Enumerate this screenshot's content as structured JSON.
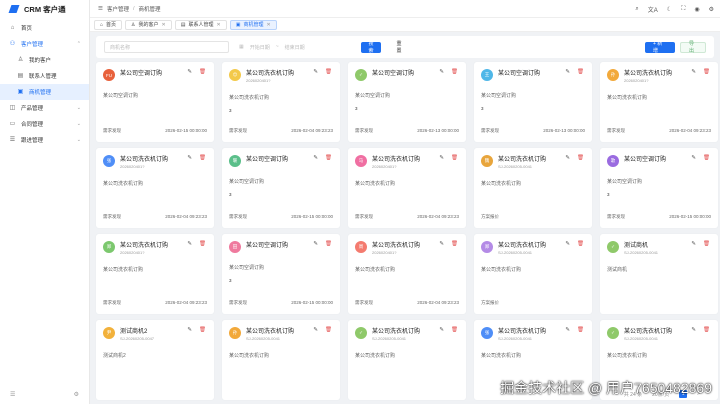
{
  "app": {
    "title": "CRM 客户通"
  },
  "sidebar": {
    "items": [
      {
        "label": "首页",
        "icon": "home-icon"
      },
      {
        "label": "客户管理",
        "icon": "user-group-icon"
      },
      {
        "label": "我的客户",
        "icon": "user-icon"
      },
      {
        "label": "联系人管理",
        "icon": "contact-icon"
      },
      {
        "label": "商机管理",
        "icon": "opportunity-icon"
      },
      {
        "label": "产品管理",
        "icon": "product-icon"
      },
      {
        "label": "合同管理",
        "icon": "contract-icon"
      },
      {
        "label": "跟进管理",
        "icon": "followup-icon"
      }
    ]
  },
  "breadcrumb": {
    "items": [
      "客户管理",
      "商机管理"
    ]
  },
  "topbar": {
    "lang": "文A"
  },
  "tabs": [
    {
      "label": "首页"
    },
    {
      "label": "我的客户"
    },
    {
      "label": "联系人管理"
    },
    {
      "label": "商机管理"
    }
  ],
  "filter": {
    "name_placeholder": "商机名称",
    "start_placeholder": "开始日期",
    "to": "~",
    "end_placeholder": "结束日期",
    "search_label": "搜索",
    "reset_label": "重置",
    "add_label": "+ 新增",
    "export_label": "导出"
  },
  "cards": [
    {
      "av": "FU",
      "color": "#e8613c",
      "name": "某公司空调订购",
      "id": "",
      "desc": "某公司空调订购",
      "num": "",
      "stage": "需求发现",
      "date": "2026-02-15 00:00:00"
    },
    {
      "av": "😊",
      "color": "#f3c94a",
      "name": "某公司洗衣机订购",
      "id": "2026020401?",
      "desc": "某公司洗衣机订购",
      "num": "3",
      "stage": "需求发现",
      "date": "2026-02-04 09:23:23"
    },
    {
      "av": "✓",
      "color": "#8fc96a",
      "name": "某公司空调订购",
      "id": "",
      "desc": "某公司空调订购",
      "num": "3",
      "stage": "需求发现",
      "date": "2026-02-13 00:00:00"
    },
    {
      "av": "王",
      "color": "#4fb7e8",
      "name": "某公司空调订购",
      "id": "",
      "desc": "某公司空调订购",
      "num": "3",
      "stage": "需求发现",
      "date": "2026-02-13 00:00:00"
    },
    {
      "av": "孙",
      "color": "#f2a93b",
      "name": "某公司洗衣机订购",
      "id": "2026020401?",
      "desc": "某公司洗衣机订购",
      "num": "",
      "stage": "需求发现",
      "date": "2026-02-04 09:23:23"
    },
    {
      "av": "张",
      "color": "#4f8ef7",
      "name": "某公司洗衣机订购",
      "id": "2026020401?",
      "desc": "某公司洗衣机订购",
      "num": "",
      "stage": "需求发现",
      "date": "2026-02-04 09:23:23"
    },
    {
      "av": "暖",
      "color": "#5bbf8a",
      "name": "某公司空调订购",
      "id": "",
      "desc": "某公司空调订购",
      "num": "3",
      "stage": "需求发现",
      "date": "2026-02-15 00:00:00"
    },
    {
      "av": "马",
      "color": "#f06fa2",
      "name": "某公司洗衣机订购",
      "id": "2026020401?",
      "desc": "某公司洗衣机订购",
      "num": "",
      "stage": "需求发现",
      "date": "2026-02-04 09:23:23"
    },
    {
      "av": "魏",
      "color": "#e8a53c",
      "name": "某公司洗衣机订购",
      "id": "SJ-20260205-0041",
      "desc": "某公司洗衣机订购",
      "num": "",
      "stage": "方案报价",
      "date": ""
    },
    {
      "av": "歌",
      "color": "#9a6be0",
      "name": "某公司空调订购",
      "id": "",
      "desc": "某公司空调订购",
      "num": "3",
      "stage": "需求发现",
      "date": "2026-02-15 00:00:00"
    },
    {
      "av": "郑",
      "color": "#7cc86e",
      "name": "某公司洗衣机订购",
      "id": "2026020401?",
      "desc": "某公司洗衣机订购",
      "num": "",
      "stage": "需求发现",
      "date": "2026-02-04 09:23:23"
    },
    {
      "av": "田",
      "color": "#ef7a9e",
      "name": "某公司空调订购",
      "id": "",
      "desc": "某公司空调订购",
      "num": "3",
      "stage": "需求发现",
      "date": "2026-02-15 00:00:00"
    },
    {
      "av": "周",
      "color": "#f47b6f",
      "name": "某公司洗衣机订购",
      "id": "2026020401?",
      "desc": "某公司洗衣机订购",
      "num": "",
      "stage": "需求发现",
      "date": "2026-02-04 09:23:23"
    },
    {
      "av": "郑",
      "color": "#b48be6",
      "name": "某公司洗衣机订购",
      "id": "SJ-20260205-0041",
      "desc": "某公司洗衣机订购",
      "num": "",
      "stage": "方案报价",
      "date": ""
    },
    {
      "av": "✓",
      "color": "#8fc96a",
      "name": "测试商机",
      "id": "SJ-20260205-0041",
      "desc": "测试商机",
      "num": "",
      "stage": "",
      "date": ""
    },
    {
      "av": "尹",
      "color": "#f2b13b",
      "name": "测试商机2",
      "id": "SJ-20260205-0047",
      "desc": "测试商机2",
      "num": "",
      "stage": "",
      "date": ""
    },
    {
      "av": "孙",
      "color": "#f2a93b",
      "name": "某公司洗衣机订购",
      "id": "SJ-20260205-0041",
      "desc": "某公司洗衣机订购",
      "num": "",
      "stage": "",
      "date": ""
    },
    {
      "av": "✓",
      "color": "#8fc96a",
      "name": "某公司洗衣机订购",
      "id": "SJ-20260205-0041",
      "desc": "某公司洗衣机订购",
      "num": "",
      "stage": "",
      "date": ""
    },
    {
      "av": "张",
      "color": "#4f8ef7",
      "name": "某公司洗衣机订购",
      "id": "SJ-20260205-0041",
      "desc": "某公司洗衣机订购",
      "num": "",
      "stage": "",
      "date": ""
    },
    {
      "av": "✓",
      "color": "#8fc96a",
      "name": "某公司洗衣机订购",
      "id": "SJ-20260205-0041",
      "desc": "某公司洗衣机订购",
      "num": "",
      "stage": "",
      "date": ""
    }
  ],
  "pager": {
    "total": "共 24 条",
    "size": "20条/页",
    "current": "1",
    "next": ">"
  },
  "watermark": {
    "text": "掘金技术社区 @ 用户7650482869"
  }
}
